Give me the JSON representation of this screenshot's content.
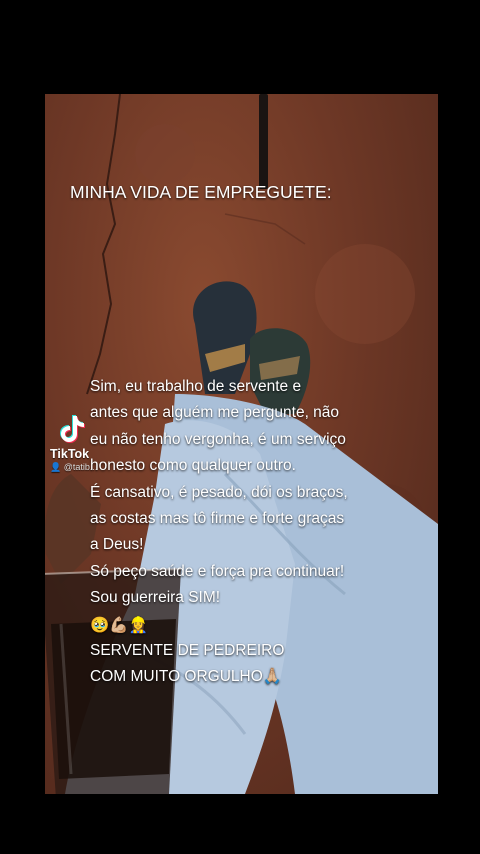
{
  "title": "MINHA VIDA DE EMPREGUETE:",
  "watermark": {
    "brand": "TikTok",
    "username": "@tatib..."
  },
  "caption_lines": [
    "Sim, eu trabalho de servente e",
    "antes que alguém me pergunte, não",
    "eu não tenho vergonha, é um serviço",
    "honesto como qualquer outro.",
    "É cansativo, é pesado, dói os braços,",
    "as costas mas tô firme e forte graças",
    "a Deus!",
    "Só peço saúde e força pra continuar!",
    "Sou guerreira SIM!",
    "🥹💪🏼👷‍♀️",
    "SERVENTE DE PEDREIRO",
    "COM MUITO ORGULHO🙏🏼"
  ],
  "colors": {
    "background": "#000000",
    "ground": "#6e3826",
    "jeans": "#a9bfd8",
    "text": "#ffffff"
  }
}
